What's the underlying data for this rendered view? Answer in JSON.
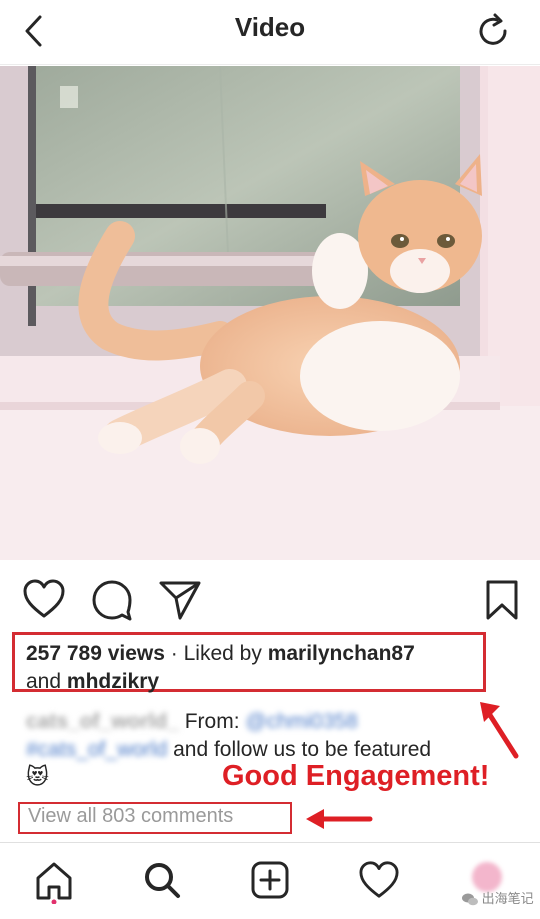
{
  "header": {
    "title": "Video"
  },
  "post": {
    "views": "257 789 views",
    "liked_by_prefix": "· Liked by",
    "liked_user_1": "marilynchan87",
    "liked_and": "and",
    "liked_user_2": "mhdzikry",
    "caption": {
      "author": "cats_of_world_",
      "from_label": "From:",
      "from_handle": "@chmi0358",
      "tag": "#cats_of_world",
      "text": "and follow us to be featured",
      "emoji": "😻"
    },
    "view_comments": "View all 803 comments"
  },
  "annotations": {
    "engagement": "Good Engagement!",
    "accent_color": "#de1f25"
  },
  "bottom_nav": {
    "items": [
      "home-icon",
      "search-icon",
      "add-icon",
      "activity-heart-icon",
      "profile-avatar"
    ]
  },
  "watermark": "出海笔记"
}
